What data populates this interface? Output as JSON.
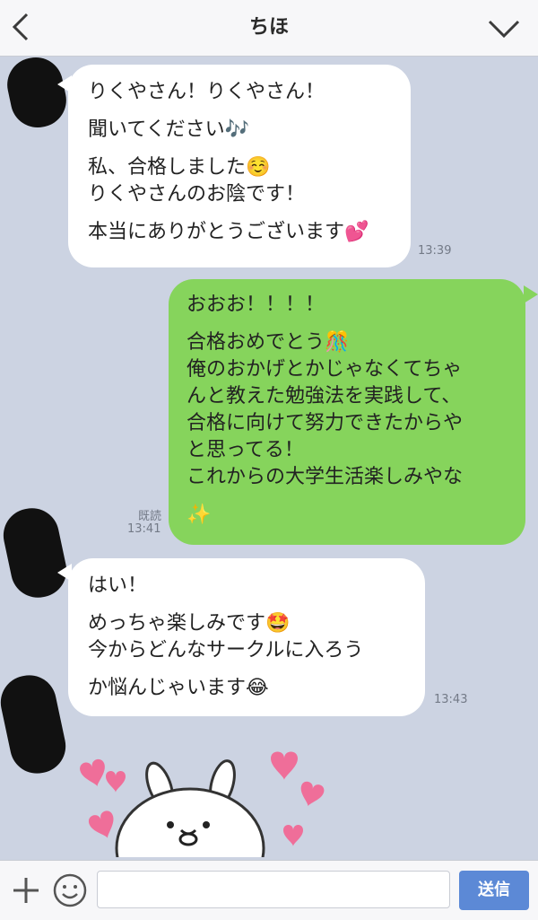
{
  "header": {
    "title": "ちほ",
    "back_icon": "chevron-left-icon",
    "menu_icon": "chevron-down-icon"
  },
  "messages": [
    {
      "direction": "in",
      "lines": [
        "りくやさん！りくやさん！",
        "聞いてください🎶",
        "私、合格しました☺️",
        "りくやさんのお陰です！",
        "本当にありがとうございます💕"
      ],
      "time": "13:39"
    },
    {
      "direction": "out",
      "lines": [
        "おおお！！！！",
        "合格おめでとう🎊",
        "俺のおかげとかじゃなくてちゃ",
        "んと教えた勉強法を実践して、",
        "合格に向けて努力できたからや",
        "と思ってる！",
        "これからの大学生活楽しみやな",
        "✨"
      ],
      "read": "既読",
      "time": "13:41"
    },
    {
      "direction": "in",
      "lines": [
        "はい！",
        "めっちゃ楽しみです🤩",
        "今からどんなサークルに入ろう",
        "か悩んじゃいます😂"
      ],
      "time": "13:43"
    }
  ],
  "footer": {
    "plus_icon": "plus-icon",
    "emoji_icon": "smiley-icon",
    "input_value": "",
    "send_label": "送信"
  },
  "colors": {
    "background": "#ccd3e2",
    "outgoing_bubble": "#86d45c",
    "incoming_bubble": "#ffffff",
    "send_button": "#5c89d6"
  }
}
